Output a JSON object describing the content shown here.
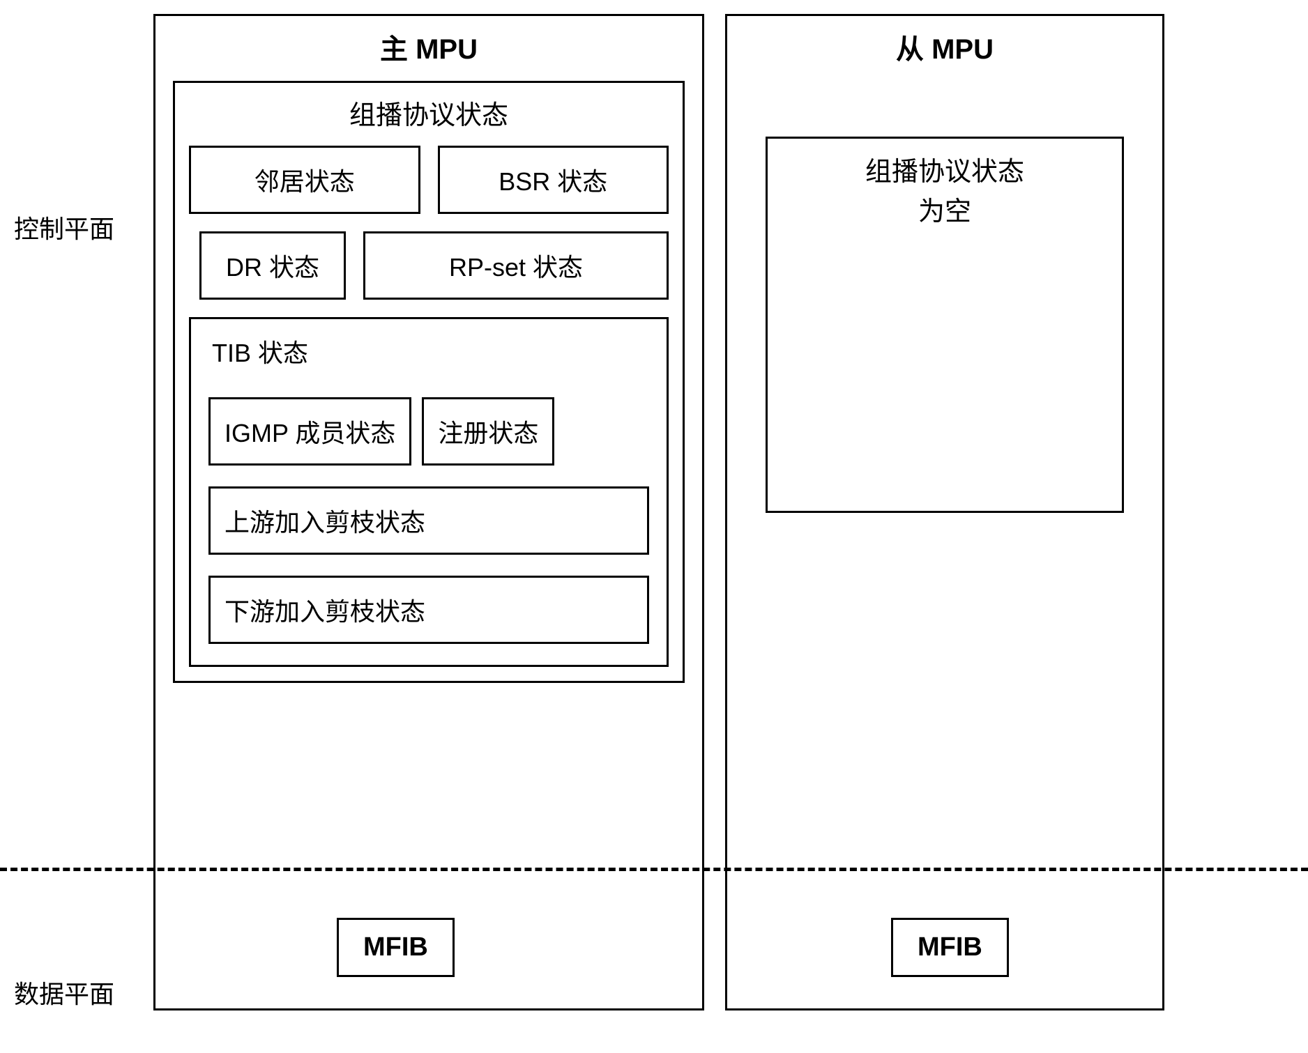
{
  "labels": {
    "control_plane": "控制平面",
    "data_plane": "数据平面"
  },
  "main_mpu": {
    "title": "主 MPU",
    "protocol_state": {
      "title": "组播协议状态",
      "neighbor": "邻居状态",
      "bsr": "BSR 状态",
      "dr": "DR 状态",
      "rpset": "RP-set 状态",
      "tib": {
        "title": "TIB 状态",
        "igmp": "IGMP 成员状态",
        "register": "注册状态",
        "upstream": "上游加入剪枝状态",
        "downstream": "下游加入剪枝状态"
      }
    },
    "mfib": "MFIB"
  },
  "slave_mpu": {
    "title": "从 MPU",
    "protocol_state_line1": "组播协议状态",
    "protocol_state_line2": "为空",
    "mfib": "MFIB"
  }
}
